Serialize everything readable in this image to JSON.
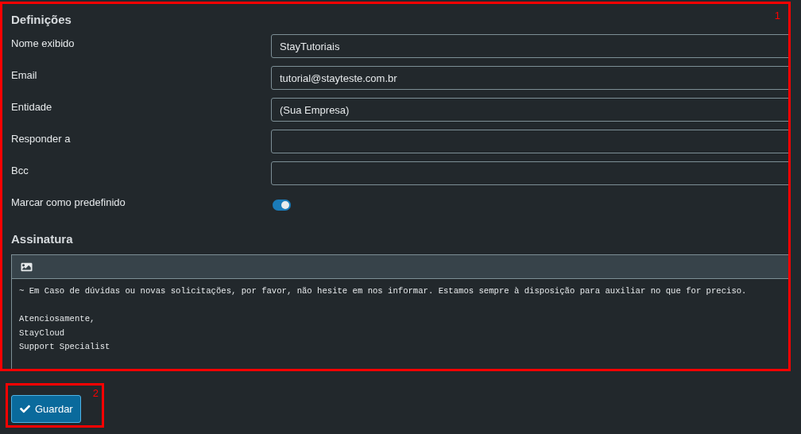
{
  "settings": {
    "title": "Definições",
    "fields": [
      {
        "kind": "text",
        "label": "Nome exibido",
        "value": "StayTutoriais"
      },
      {
        "kind": "text",
        "label": "Email",
        "value": "tutorial@stayteste.com.br"
      },
      {
        "kind": "text",
        "label": "Entidade",
        "value": "(Sua Empresa)"
      },
      {
        "kind": "text",
        "label": "Responder a"
      },
      {
        "kind": "text",
        "label": "Bcc"
      },
      {
        "kind": "toggle",
        "label": "Marcar como predefinido",
        "on": true
      }
    ]
  },
  "signature": {
    "title": "Assinatura",
    "paragraphs": [
      [
        "~ Em Caso de dúvidas ou novas solicitações, por favor, não hesite em nos informar. Estamos sempre à disposição para auxiliar no que for preciso."
      ],
      [
        "Atenciosamente,",
        "StayCloud",
        "Support Specialist"
      ]
    ]
  },
  "save_button": {
    "label": "Guardar"
  },
  "annotations": [
    {
      "label": "1"
    },
    {
      "label": "2"
    }
  ]
}
